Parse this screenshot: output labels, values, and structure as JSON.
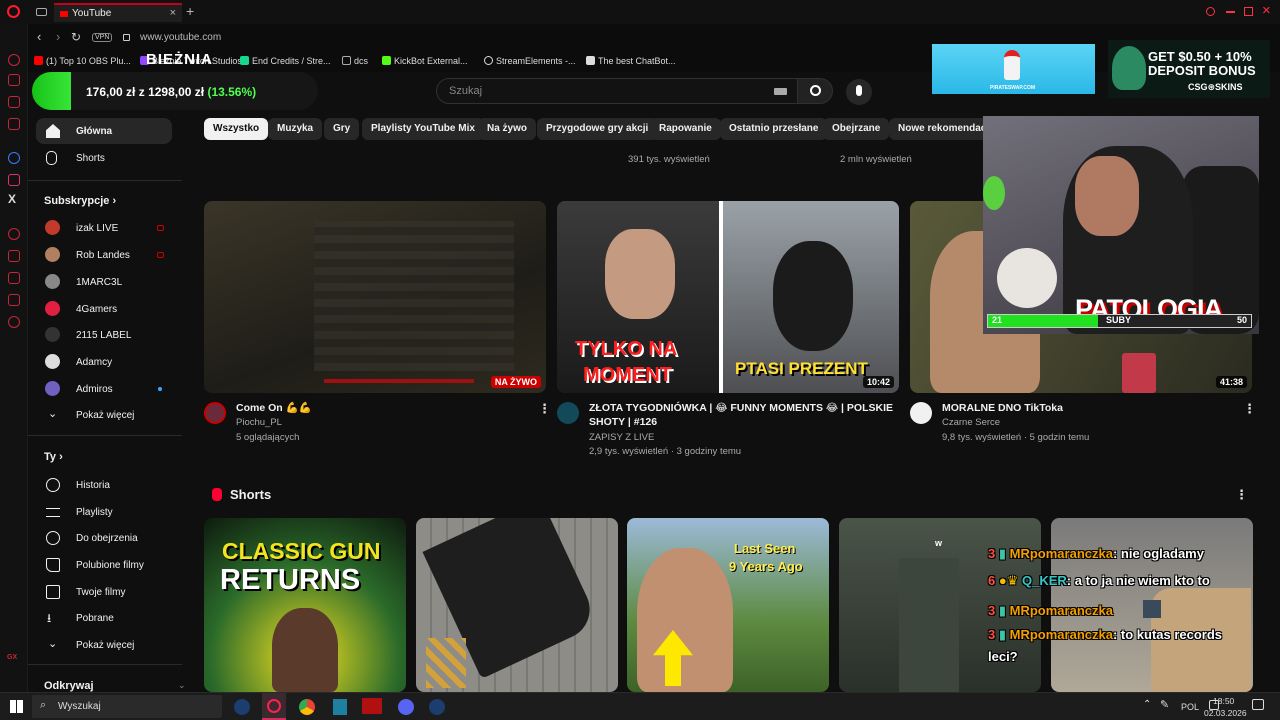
{
  "browser": {
    "tab_title": "YouTube",
    "new_tab_label": "+",
    "url": "www.youtube.com",
    "vpn_label": "VPN",
    "bookmarks": [
      {
        "label": "(1) Top 10 OBS Plu...",
        "color": "#ff0000"
      },
      {
        "label": "Bieżnia Twitch Studios...",
        "color": "#9146ff"
      },
      {
        "label": "End Credits / Stre...",
        "color": "#18d690"
      },
      {
        "label": "dcs",
        "color": "#777777"
      },
      {
        "label": "KickBot External...",
        "color": "#53fc18"
      },
      {
        "label": "StreamElements -...",
        "color": "#ffffff"
      },
      {
        "label": "The best ChatBot...",
        "color": "#ffffff"
      }
    ]
  },
  "overlay_ticker": {
    "title": "BIEŻNIA",
    "left_amount": "176,00 zł",
    "sep": "z",
    "goal_amount": "1298,00 zł",
    "percent": "(13.56%)",
    "progress": 0.1356
  },
  "youtube": {
    "search_placeholder": "Szukaj",
    "chips": [
      "Wszystko",
      "Muzyka",
      "Gry",
      "Playlisty YouTube Mix",
      "Na żywo",
      "Przygodowe gry akcji",
      "Rapowanie",
      "Ostatnio przesłane",
      "Obejrzane",
      "Nowe rekomendacje"
    ],
    "top_meta": [
      "391 tys. wyświetleń",
      "2 mln wyświetleń"
    ],
    "nav_main": [
      {
        "label": "Główna",
        "icon": "home-icon"
      },
      {
        "label": "Shorts",
        "icon": "shorts-icon"
      }
    ],
    "subs_heading": "Subskrypcje",
    "subscriptions": [
      {
        "label": "izak LIVE",
        "live": true,
        "color": "#c23a2a"
      },
      {
        "label": "Rob Landes",
        "live": true,
        "color": "#b08060"
      },
      {
        "label": "1MARC3L",
        "live": false,
        "color": "#888888"
      },
      {
        "label": "4Gamers",
        "live": false,
        "color": "#e02040"
      },
      {
        "label": "2115 LABEL",
        "live": false,
        "color": "#333333"
      },
      {
        "label": "Adamcy",
        "live": false,
        "color": "#dddddd"
      },
      {
        "label": "Admiros",
        "live": false,
        "color": "#7060c0"
      }
    ],
    "show_more": "Pokaż więcej",
    "you_heading": "Ty",
    "you_items": [
      {
        "label": "Historia",
        "icon": "history-icon"
      },
      {
        "label": "Playlisty",
        "icon": "playlist-icon"
      },
      {
        "label": "Do obejrzenia",
        "icon": "watch-later-icon"
      },
      {
        "label": "Polubione filmy",
        "icon": "thumb-up-icon"
      },
      {
        "label": "Twoje filmy",
        "icon": "your-videos-icon"
      },
      {
        "label": "Pobrane",
        "icon": "download-icon"
      },
      {
        "label": "Pokaż więcej",
        "icon": "chevron-down-icon"
      }
    ],
    "explore_heading": "Odkrywaj",
    "videos": [
      {
        "title": "Come On 💪💪",
        "title2": "",
        "channel": "Piochu_PL",
        "meta": "5 oglądających",
        "badge": "NA ŻYWO",
        "live": true
      },
      {
        "title": "ZŁOTA TYGODNIÓWKA | 😂 FUNNY MOMENTS 😂 | POLSKIE",
        "title2": "SHOTY | #126",
        "channel": "ZAPISY Z LIVE",
        "meta": "2,9 tys. wyświetleń · 3 godziny temu",
        "badge": "10:42",
        "live": false,
        "overlay1": "TYLKO NA",
        "overlay2": "MOMENT",
        "overlay3": "PTASI PREZENT"
      },
      {
        "title": "MORALNE DNO TikToka",
        "title2": "",
        "channel": "Czarne Serce",
        "meta": "9,8 tys. wyświetleń · 5 godzin temu",
        "badge": "41:38",
        "live": false
      }
    ],
    "shorts_heading": "Shorts",
    "shorts": [
      {
        "line1": "CLASSIC GUN",
        "line2": "RETURNS"
      },
      {
        "line1": "",
        "line2": ""
      },
      {
        "line1": "Last Seen",
        "line2": "9 Years Ago"
      },
      {
        "line1": "",
        "line2": ""
      },
      {
        "line1": "",
        "line2": ""
      }
    ]
  },
  "stream_overlay": {
    "ad1_label": "PIRATESWAP.COM",
    "ad2_line1": "GET $0.50 + 10%",
    "ad2_line2": "DEPOSIT BONUS",
    "ad2_brand": "CSG⊛SKINS",
    "cam_banner": "PATOLOGIA",
    "sub_goal_current": "21",
    "sub_goal_label": "SUBY",
    "sub_goal_target": "50",
    "sub_goal_fraction": 0.42,
    "chat": [
      {
        "level": "3",
        "name": "MRpomaranczka",
        "msg": ": nie ogladamy"
      },
      {
        "level": "6",
        "name": "Q_KER",
        "msg": ": a to ja nie wiem kto to"
      },
      {
        "level": "3",
        "name": "MRpomaranczka",
        "msg": ""
      },
      {
        "level": "3",
        "name": "MRpomaranczka",
        "msg": ": to kutas records"
      },
      {
        "level": "",
        "name": "",
        "msg": "leci?"
      }
    ]
  },
  "taskbar": {
    "search": "Wyszukaj",
    "lang": "POL",
    "time": "18:50",
    "date": "02.03.2026"
  }
}
